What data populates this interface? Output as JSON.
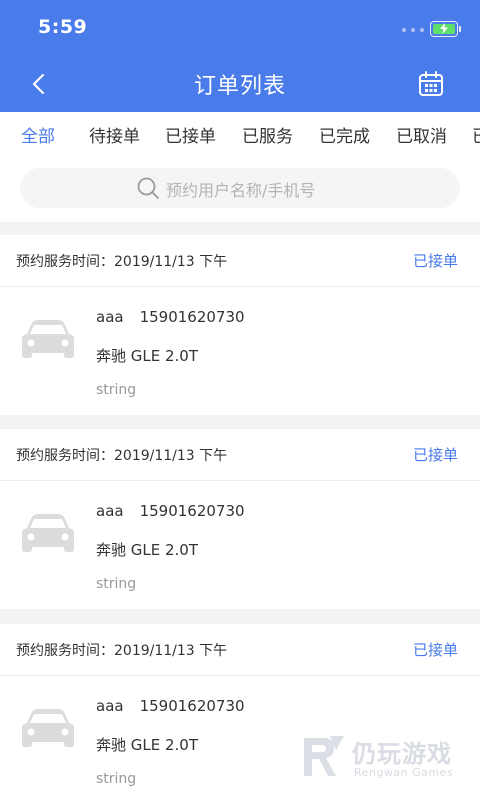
{
  "status_bar": {
    "time": "5:59"
  },
  "header": {
    "title": "订单列表"
  },
  "tabs": [
    {
      "label": "全部",
      "active": true
    },
    {
      "label": "待接单"
    },
    {
      "label": "已接单"
    },
    {
      "label": "已服务"
    },
    {
      "label": "已完成"
    },
    {
      "label": "已取消"
    },
    {
      "label": "已"
    }
  ],
  "search": {
    "placeholder": "预约用户名称/手机号"
  },
  "orders": [
    {
      "service_time": "预约服务时间：2019/11/13 下午",
      "status": "已接单",
      "user": "aaa",
      "phone": "15901620730",
      "car": "奔驰 GLE 2.0T",
      "note": "string"
    },
    {
      "service_time": "预约服务时间：2019/11/13 下午",
      "status": "已接单",
      "user": "aaa",
      "phone": "15901620730",
      "car": "奔驰 GLE 2.0T",
      "note": "string"
    },
    {
      "service_time": "预约服务时间：2019/11/13 下午",
      "status": "已接单",
      "user": "aaa",
      "phone": "15901620730",
      "car": "奔驰 GLE 2.0T",
      "note": "string"
    }
  ],
  "watermark": {
    "title": "仍玩游戏",
    "subtitle": "Rengwan Games"
  },
  "colors": {
    "primary": "#4a7bea",
    "background": "#f2f3f5",
    "muted": "#999999"
  }
}
